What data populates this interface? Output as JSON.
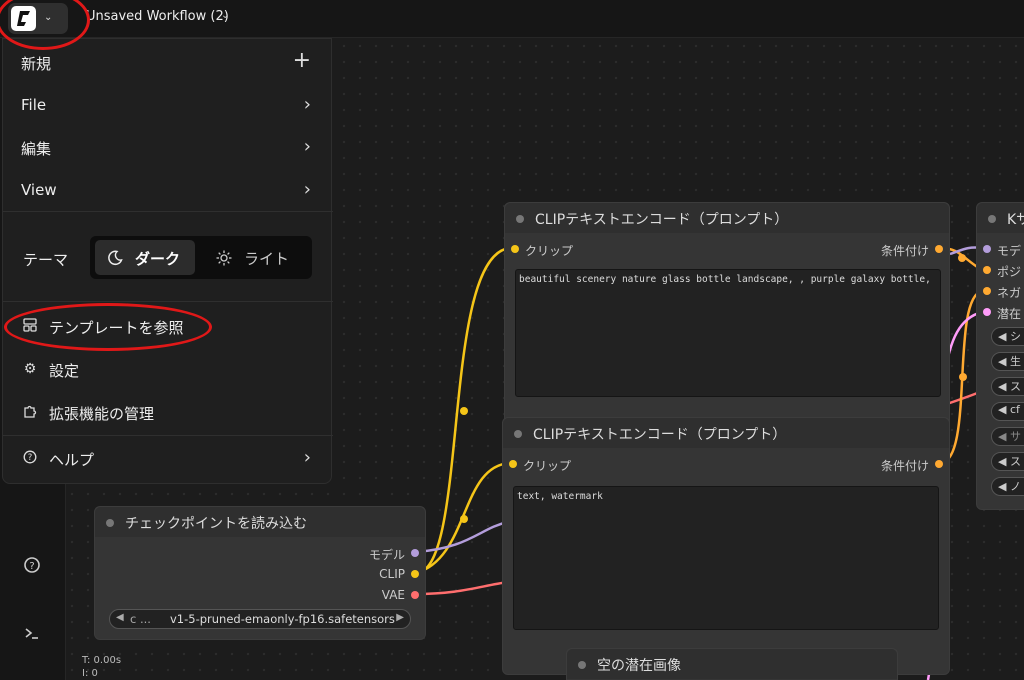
{
  "topbar": {
    "workflow_title": "Unsaved Workflow (2)",
    "chevron": "⌄"
  },
  "menu": {
    "new": "新規",
    "file": "File",
    "edit": "編集",
    "view": "View",
    "theme_label": "テーマ",
    "theme_dark": "ダーク",
    "theme_light": "ライト",
    "browse_templates": "テンプレートを参照",
    "settings": "設定",
    "manage_extensions": "拡張機能の管理",
    "help": "ヘルプ",
    "plus": "+",
    "arrow": "›"
  },
  "nodes": {
    "clip_pos": {
      "title": "CLIPテキストエンコード（プロンプト）",
      "input_clip": "クリップ",
      "output_cond": "条件付け",
      "text": "beautiful scenery nature glass bottle landscape, , purple galaxy bottle,"
    },
    "clip_neg": {
      "title": "CLIPテキストエンコード（プロンプト）",
      "input_clip": "クリップ",
      "output_cond": "条件付け",
      "text": "text, watermark"
    },
    "checkpoint": {
      "title": "チェックポイントを読み込む",
      "out_model": "モデル",
      "out_clip": "CLIP",
      "out_vae": "VAE",
      "ckpt_prefix": "c ...",
      "ckpt_name": "v1-5-pruned-emaonly-fp16.safetensors",
      "left_arrow": "◀",
      "right_arrow": "▶"
    },
    "ksampler": {
      "title": "Kサ",
      "in_model": "モデ",
      "in_positive": "ポジ",
      "in_negative": "ネガ",
      "in_latent": "潜在",
      "widgets": [
        "◀ シ",
        "◀ 生",
        "◀ ス",
        "◀ cf",
        "◀ サ",
        "◀ ス",
        "◀ ノ"
      ]
    },
    "empty_latent": {
      "title": "空の潜在画像"
    }
  },
  "stats": {
    "time": "T: 0.00s",
    "index": "I: 0"
  },
  "colors": {
    "clip_yellow": "#f5c518",
    "model_lavender": "#b39ddb",
    "vae_red": "#ff6e6e",
    "cond_orange": "#ffa931",
    "latent_pink": "#ff9cf9",
    "annotation_red": "#e01818"
  }
}
